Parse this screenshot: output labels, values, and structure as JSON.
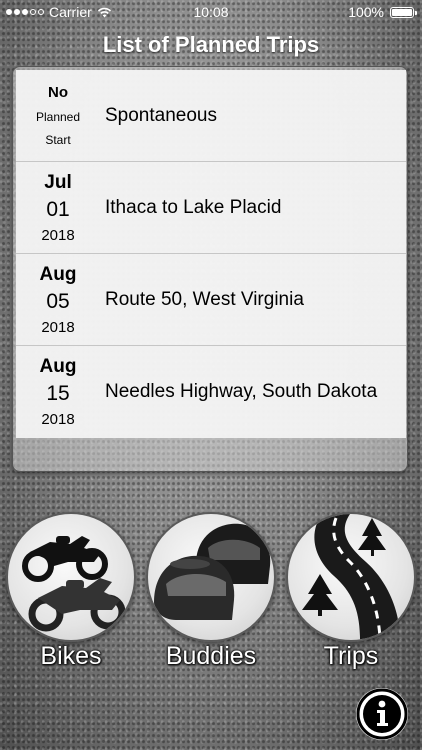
{
  "status_bar": {
    "carrier": "Carrier",
    "time": "10:08",
    "battery": "100%",
    "icons": [
      "signal-dots-icon",
      "wifi-icon",
      "battery-icon"
    ]
  },
  "header": {
    "title": "List of Planned Trips"
  },
  "trips": [
    {
      "no_planned": [
        "No",
        "Planned",
        "Start"
      ],
      "name": "Spontaneous"
    },
    {
      "month": "Jul",
      "day": "01",
      "year": "2018",
      "name": "Ithaca to Lake Placid"
    },
    {
      "month": "Aug",
      "day": "05",
      "year": "2018",
      "name": "Route 50, West Virginia"
    },
    {
      "month": "Aug",
      "day": "15",
      "year": "2018",
      "name": "Needles Highway, South Dakota"
    }
  ],
  "nav": {
    "bikes": {
      "label": "Bikes",
      "icon": "motorcycles-icon"
    },
    "buddies": {
      "label": "Buddies",
      "icon": "helmets-icon"
    },
    "trips": {
      "label": "Trips",
      "icon": "road-icon"
    }
  },
  "info_button": {
    "icon": "info-icon"
  }
}
